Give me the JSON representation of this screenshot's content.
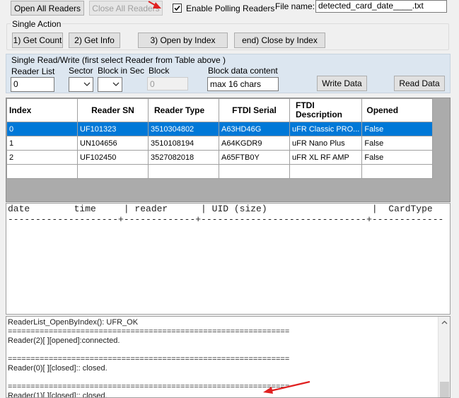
{
  "top": {
    "open_all_label": "Open All Readers",
    "close_all_label": "Close All Readers",
    "polling_checkbox_label": "Enable Polling Readers",
    "polling_checked": true,
    "file_name_label": "File name:",
    "file_name_value": "detected_card_date____.txt"
  },
  "single_action": {
    "title": "Single Action",
    "get_count_label": "1) Get Count",
    "get_info_label": "2) Get Info",
    "open_by_index_label": "3) Open by Index",
    "close_by_index_label": "end) Close by Index"
  },
  "single_rw": {
    "title": "Single Read/Write  (first select Reader from Table above )",
    "reader_list_label": "Reader List",
    "reader_list_value": "0",
    "sector_label": "Sector",
    "block_in_sec_label": "Block in Sec",
    "block_label": "Block",
    "block_value": "0",
    "block_data_label": "Block data content",
    "block_data_value": "max 16 chars",
    "write_label": "Write Data",
    "read_label": "Read Data"
  },
  "reader_table": {
    "columns": [
      "Index",
      "Reader SN",
      "Reader Type",
      "FTDI Serial",
      "FTDI Description",
      "Opened"
    ],
    "rows": [
      [
        "0",
        "UF101323",
        "3510304802",
        "A63HD46G",
        "uFR Classic PRO...",
        "False"
      ],
      [
        "1",
        "UN104656",
        "3510108194",
        "A64KGDR9",
        "uFR Nano Plus",
        "False"
      ],
      [
        "2",
        "UF102450",
        "3527082018",
        "A65FTB0Y",
        "uFR XL RF AMP",
        "False"
      ],
      [
        "",
        "",
        "",
        "",
        "",
        ""
      ]
    ],
    "selected_row": 0
  },
  "card_log": {
    "header_line": "date        time     | reader      | UID (size)                   |  CardType",
    "separator_line": "--------------------+-------------+------------------------------+-------------"
  },
  "status_log": {
    "lines": [
      "ReaderList_OpenByIndex(): UFR_OK",
      "==============================================================",
      "Reader(2)[ ][opened]:connected.",
      "",
      "==============================================================",
      "Reader(0)[ ][closed]:: closed.",
      "",
      "==============================================================",
      "Reader(1)[ ][closed]:: closed."
    ]
  },
  "colors": {
    "selection": "#0078d7",
    "annotation_arrow": "#e02020",
    "panel_blue": "#dce6f0"
  },
  "icons": {
    "checkbox": "checkmark-icon",
    "combo_arrow": "chevron-down-icon",
    "scroll_up": "chevron-up-icon",
    "annotation": "red-arrow-icon"
  }
}
